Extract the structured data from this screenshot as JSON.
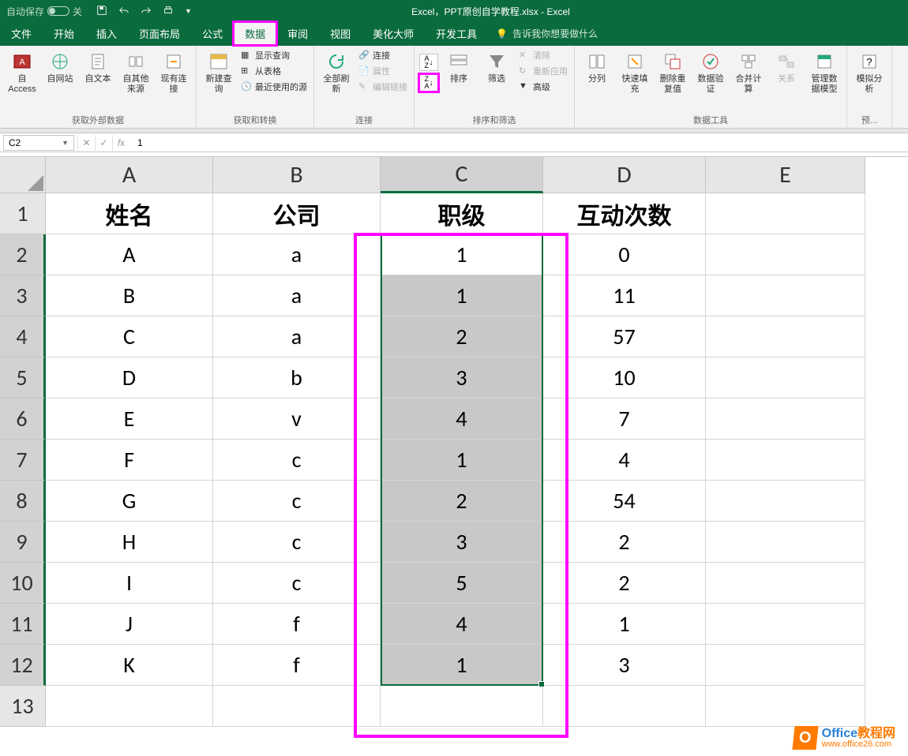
{
  "title": "Excel，PPT原创自学教程.xlsx - Excel",
  "autosave_label": "自动保存",
  "autosave_state": "关",
  "menubar": [
    "文件",
    "开始",
    "插入",
    "页面布局",
    "公式",
    "数据",
    "审阅",
    "视图",
    "美化大师",
    "开发工具"
  ],
  "menubar_active_index": 5,
  "tell_me": "告诉我你想要做什么",
  "ribbon": {
    "group_get_external": {
      "title": "获取外部数据",
      "items": [
        "自 Access",
        "自网站",
        "自文本",
        "自其他来源",
        "现有连接"
      ]
    },
    "group_get_transform": {
      "title": "获取和转换",
      "big": "新建查询",
      "small": [
        "显示查询",
        "从表格",
        "最近使用的源"
      ]
    },
    "group_connection": {
      "title": "连接",
      "big": "全部刷新",
      "small": [
        "连接",
        "属性",
        "编辑链接"
      ]
    },
    "group_sort_filter": {
      "title": "排序和筛选",
      "az": "A→Z",
      "za": "Z→A",
      "sort": "排序",
      "filter": "筛选",
      "small": [
        "清除",
        "重新应用",
        "高级"
      ]
    },
    "group_data_tools": {
      "title": "数据工具",
      "items": [
        "分列",
        "快速填充",
        "删除重复值",
        "数据验证",
        "合并计算",
        "关系",
        "管理数据模型"
      ]
    },
    "group_forecast": {
      "title": "预...",
      "items": [
        "模拟分析"
      ]
    }
  },
  "name_box": "C2",
  "formula_value": "1",
  "columns": [
    "A",
    "B",
    "C",
    "D",
    "E"
  ],
  "rows": [
    "1",
    "2",
    "3",
    "4",
    "5",
    "6",
    "7",
    "8",
    "9",
    "10",
    "11",
    "12",
    "13"
  ],
  "header_row": [
    "姓名",
    "公司",
    "职级",
    "互动次数",
    ""
  ],
  "data_rows": [
    [
      "A",
      "a",
      "1",
      "0",
      ""
    ],
    [
      "B",
      "a",
      "1",
      "11",
      ""
    ],
    [
      "C",
      "a",
      "2",
      "57",
      ""
    ],
    [
      "D",
      "b",
      "3",
      "10",
      ""
    ],
    [
      "E",
      "v",
      "4",
      "7",
      ""
    ],
    [
      "F",
      "c",
      "1",
      "4",
      ""
    ],
    [
      "G",
      "c",
      "2",
      "54",
      ""
    ],
    [
      "H",
      "c",
      "3",
      "2",
      ""
    ],
    [
      "I",
      "c",
      "5",
      "2",
      ""
    ],
    [
      "J",
      "f",
      "4",
      "1",
      ""
    ],
    [
      "K",
      "f",
      "1",
      "3",
      ""
    ],
    [
      "",
      "",
      "",
      "",
      ""
    ]
  ],
  "watermark": {
    "line1a": "Office",
    "line1b": "教程网",
    "line2": "www.office26.com",
    "o": "O"
  }
}
